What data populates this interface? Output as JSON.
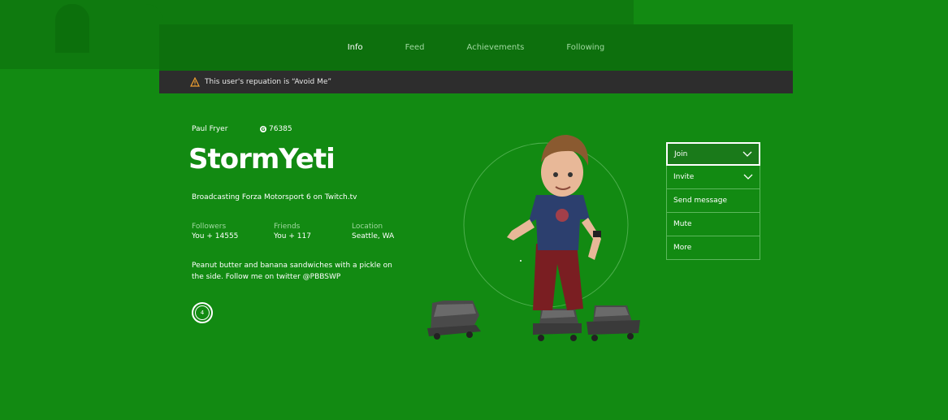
{
  "tabs": [
    {
      "label": "Info",
      "active": true
    },
    {
      "label": "Feed",
      "active": false
    },
    {
      "label": "Achievements",
      "active": false
    },
    {
      "label": "Following",
      "active": false
    }
  ],
  "warning": {
    "text": "This user's repuation is “Avoid Me”",
    "icon": "warning-triangle-icon"
  },
  "profile": {
    "real_name": "Paul Fryer",
    "gamerscore": "76385",
    "gamertag": "StormYeti",
    "broadcast": "Broadcasting Forza Motorsport 6 on Twitch.tv",
    "bio": "Peanut butter and banana sandwiches with a pickle on the side. Follow me on twitter @PBBSWP",
    "reputation_level": "4"
  },
  "stats": {
    "followers": {
      "label": "Followers",
      "value": "You + 14555"
    },
    "friends": {
      "label": "Friends",
      "value": "You + 117"
    },
    "location": {
      "label": "Location",
      "value": "Seattle, WA"
    }
  },
  "menu": [
    {
      "label": "Join",
      "has_chevron": true
    },
    {
      "label": "Invite",
      "has_chevron": true
    },
    {
      "label": "Send message",
      "has_chevron": false
    },
    {
      "label": "Mute",
      "has_chevron": false
    },
    {
      "label": "More",
      "has_chevron": false
    }
  ],
  "colors": {
    "background": "#128a12",
    "bar": "#0d700d",
    "warning_bar": "#2d2d2d",
    "warning_icon": "#f0a030"
  }
}
